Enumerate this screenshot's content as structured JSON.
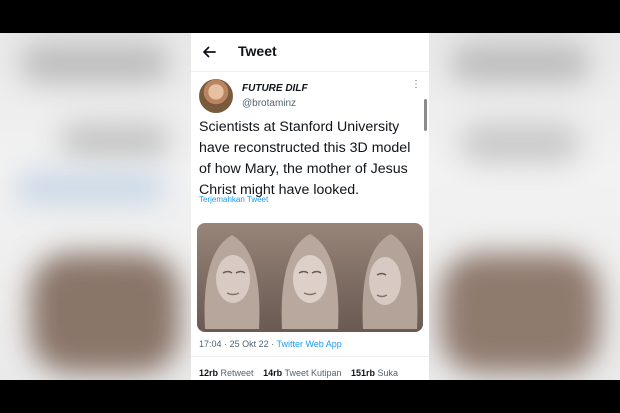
{
  "header": {
    "title": "Tweet"
  },
  "tweet": {
    "author_name": "FUTURE DILF",
    "author_handle": "@brotaminz",
    "text": "Scientists at Stanford University have reconstructed this 3D model of how Mary, the mother of Jesus Christ might have looked.",
    "translate_label": "Terjemahkan Tweet",
    "time": "17:04",
    "date": "25 Okt 22",
    "separator": "·",
    "source": "Twitter Web App",
    "stats": {
      "retweets_count": "12rb",
      "retweets_label": "Retweet",
      "quotes_count": "14rb",
      "quotes_label": "Tweet Kutipan",
      "likes_count": "151rb",
      "likes_label": "Suka"
    }
  },
  "colors": {
    "accent": "#1d9bf0",
    "text": "#0f1419",
    "muted": "#536471"
  },
  "icons": {
    "back": "arrow-left-icon",
    "more": "more-vertical-icon"
  }
}
